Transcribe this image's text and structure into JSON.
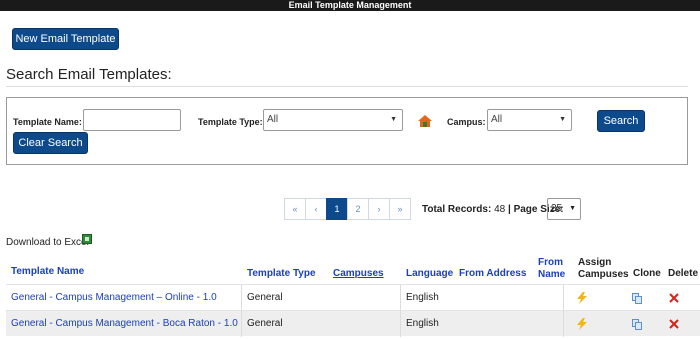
{
  "window": {
    "title": "Email Template Management"
  },
  "toolbar": {
    "new_label": "New Email Template"
  },
  "search": {
    "heading": "Search Email Templates:",
    "template_name_label": "Template Name:",
    "template_name_value": "",
    "template_type_label": "Template Type:",
    "template_type_value": "All",
    "campus_label": "Campus:",
    "campus_value": "All",
    "search_label": "Search",
    "clear_label": "Clear Search"
  },
  "pager": {
    "first": "«",
    "prev": "‹",
    "pages": [
      "1",
      "2"
    ],
    "current": "1",
    "next": "›",
    "last": "»",
    "total_label": "Total Records:",
    "total_value": "48",
    "separator": "|",
    "page_size_label": "Page Size:",
    "page_size_value": "25"
  },
  "download": {
    "label": "Download to Excel"
  },
  "table": {
    "headers": {
      "name": "Template Name",
      "type": "Template Type",
      "campuses": "Campuses",
      "language": "Language",
      "from_address": "From Address",
      "from_name_1": "From",
      "from_name_2": "Name",
      "assign_1": "Assign",
      "assign_2": "Campuses",
      "clone": "Clone",
      "delete": "Delete"
    },
    "rows": [
      {
        "name": "General - Campus Management – Online - 1.0",
        "type": "General",
        "campuses": "",
        "language": "English",
        "from_address": "",
        "from_name": ""
      },
      {
        "name": "General - Campus Management - Boca Raton - 1.0",
        "type": "General",
        "campuses": "",
        "language": "English",
        "from_address": "",
        "from_name": ""
      }
    ]
  },
  "icons": {
    "home": "home-icon",
    "bolt": "lightning-icon",
    "clone": "copy-icon",
    "delete": "x-icon",
    "excel": "excel-icon"
  },
  "colors": {
    "primary": "#0d4a8c",
    "link": "#1a3fbf",
    "bolt": "#f2b31b",
    "delete": "#d9241c"
  }
}
